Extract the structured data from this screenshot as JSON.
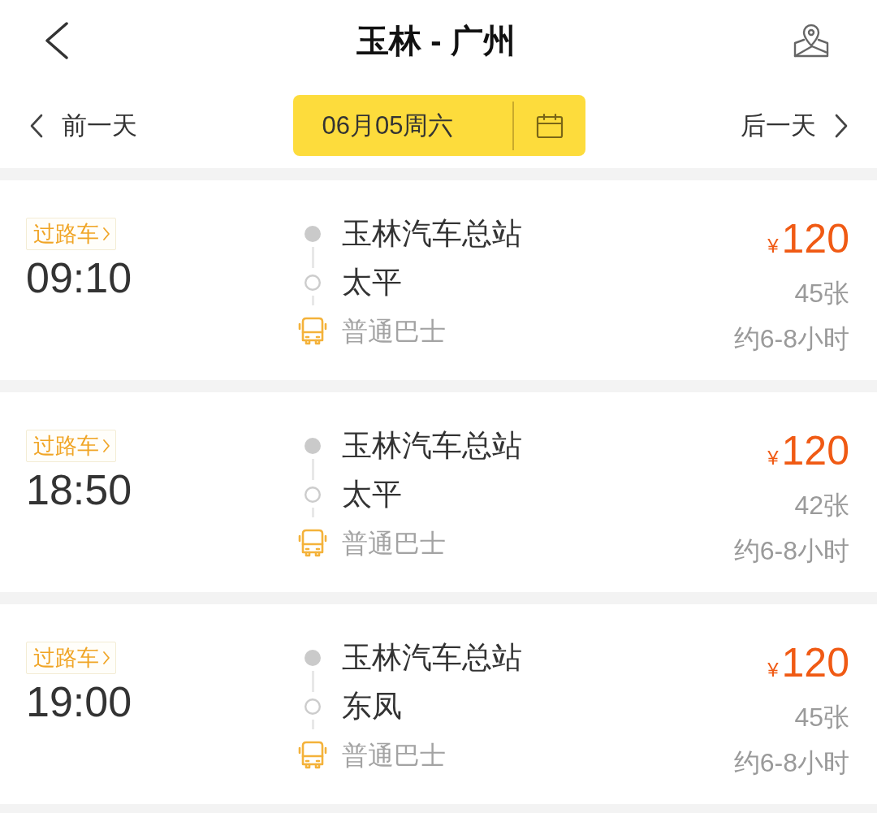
{
  "header": {
    "title": "玉林 - 广州"
  },
  "date_bar": {
    "previous": "前一天",
    "date": "06月05周六",
    "next": "后一天"
  },
  "trips": [
    {
      "tag": "过路车",
      "time": "09:10",
      "from": "玉林汽车总站",
      "to": "太平",
      "bus_type": "普通巴士",
      "currency": "¥",
      "price": "120",
      "seats": "45张",
      "duration": "约6-8小时"
    },
    {
      "tag": "过路车",
      "time": "18:50",
      "from": "玉林汽车总站",
      "to": "太平",
      "bus_type": "普通巴士",
      "currency": "¥",
      "price": "120",
      "seats": "42张",
      "duration": "约6-8小时"
    },
    {
      "tag": "过路车",
      "time": "19:00",
      "from": "玉林汽车总站",
      "to": "东凤",
      "bus_type": "普通巴士",
      "currency": "¥",
      "price": "120",
      "seats": "45张",
      "duration": "约6-8小时"
    }
  ]
}
